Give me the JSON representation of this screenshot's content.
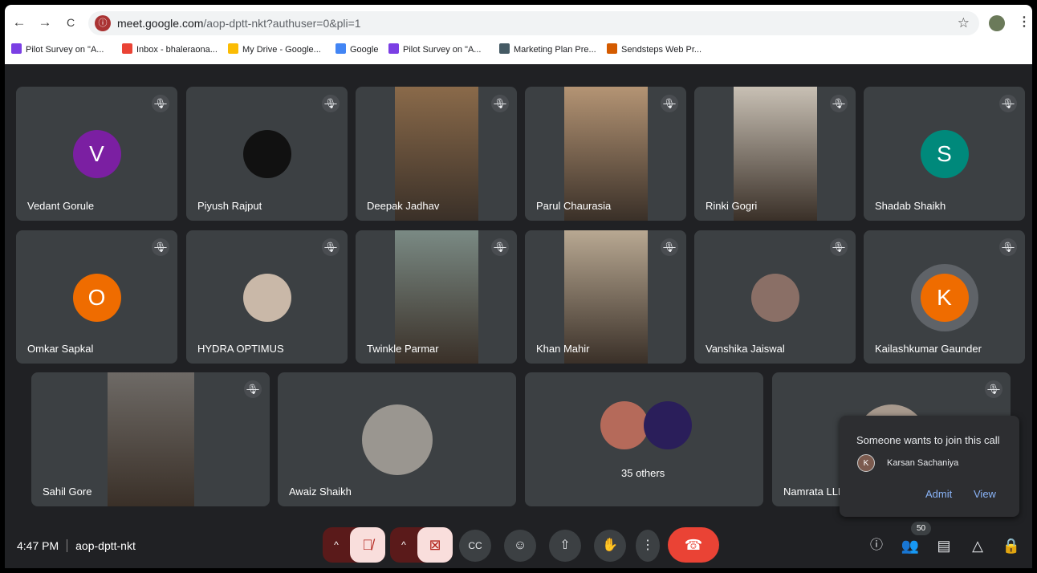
{
  "browser": {
    "url_host": "meet.google.com",
    "url_path": "/aop-dptt-nkt?authuser=0&pli=1",
    "back_icon": "←",
    "forward_icon": "→",
    "reload_icon": "C",
    "star_icon": "☆",
    "menu_icon": "⋮",
    "bookmarks": [
      {
        "label": "Pilot Survey on \"A...",
        "icon": "sheets-icon",
        "color": "#7b3fe4"
      },
      {
        "label": "Inbox - bhaleraona...",
        "icon": "gmail-icon",
        "color": "#ea4335"
      },
      {
        "label": "My Drive - Google...",
        "icon": "drive-icon",
        "color": "#fbbc04"
      },
      {
        "label": "Google",
        "icon": "google-icon",
        "color": "#4285f4"
      },
      {
        "label": "Pilot Survey on \"A...",
        "icon": "sheets-icon",
        "color": "#7b3fe4"
      },
      {
        "label": "Marketing Plan Pre...",
        "icon": "slides-icon",
        "color": "#455a64"
      },
      {
        "label": "Sendsteps Web Pr...",
        "icon": "sendsteps-icon",
        "color": "#d45b00"
      }
    ]
  },
  "participants": [
    {
      "name": "Vedant Gorule",
      "initial": "V",
      "avatar_color": "#7b1fa2"
    },
    {
      "name": "Piyush Rajput",
      "avatar_color": "#111111"
    },
    {
      "name": "Deepak Jadhav",
      "video_color": "#8a6a4a"
    },
    {
      "name": "Parul Chaurasia",
      "video_color": "#b49474"
    },
    {
      "name": "Rinki Gogri",
      "video_color": "#c8c0b4"
    },
    {
      "name": "Shadab Shaikh",
      "initial": "S",
      "avatar_color": "#00897b"
    },
    {
      "name": "Omkar Sapkal",
      "initial": "O",
      "avatar_color": "#ef6c00"
    },
    {
      "name": "HYDRA OPTIMUS",
      "avatar_color": "#c9b8a8"
    },
    {
      "name": "Twinkle Parmar",
      "video_color": "#7a8a84"
    },
    {
      "name": "Khan Mahir",
      "video_color": "#b8a892"
    },
    {
      "name": "Vanshika Jaiswal",
      "avatar_color": "#8a6f66"
    },
    {
      "name": "Kailashkumar Gaunder",
      "initial": "K",
      "avatar_color": "#ef6c00"
    },
    {
      "name": "Sahil Gore",
      "video_color": "#6e6a66"
    },
    {
      "name": "Awaiz Shaikh",
      "avatar_color": "#9a9690"
    },
    {
      "name": "Namrata LLD",
      "avatar_color": "#a89a8e"
    }
  ],
  "others_tile": {
    "label": "35 others"
  },
  "mic_off_icon": "✕̸",
  "popup": {
    "title": "Someone wants to join this call",
    "initial": "K",
    "name": "Karsan Sachaniya",
    "admit": "Admit",
    "view": "View"
  },
  "bottom": {
    "time": "4:47 PM",
    "meeting_code": "aop-dptt-nkt",
    "people_count": "50"
  }
}
